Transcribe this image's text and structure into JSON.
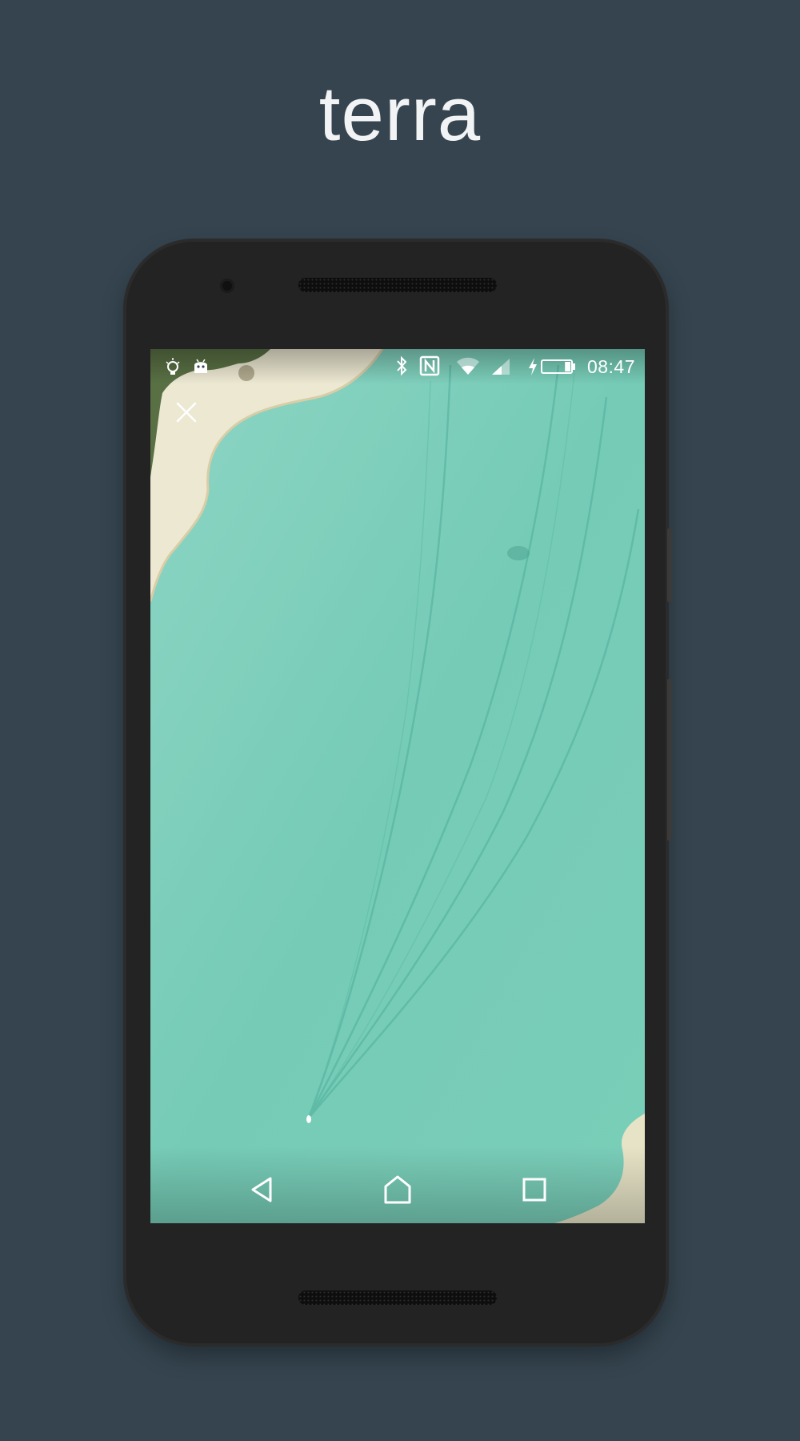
{
  "promo": {
    "title": "terra"
  },
  "device": {
    "body_color": "#232323",
    "background_color": "#35444f"
  },
  "statusbar": {
    "left_icons": [
      "lightbulb-icon",
      "android-icon"
    ],
    "right_icons": [
      "bluetooth-icon",
      "nfc-icon",
      "wifi-icon",
      "cell-signal-icon",
      "charging-icon",
      "battery-icon"
    ],
    "time": "08:47",
    "battery_level": 0.2
  },
  "wallpaper": {
    "water_color": "#6cc7b1",
    "sand_color": "#ece8d2",
    "close_icon": "close-icon"
  },
  "navbar": {
    "buttons": [
      "back-icon",
      "home-icon",
      "recents-icon"
    ]
  }
}
